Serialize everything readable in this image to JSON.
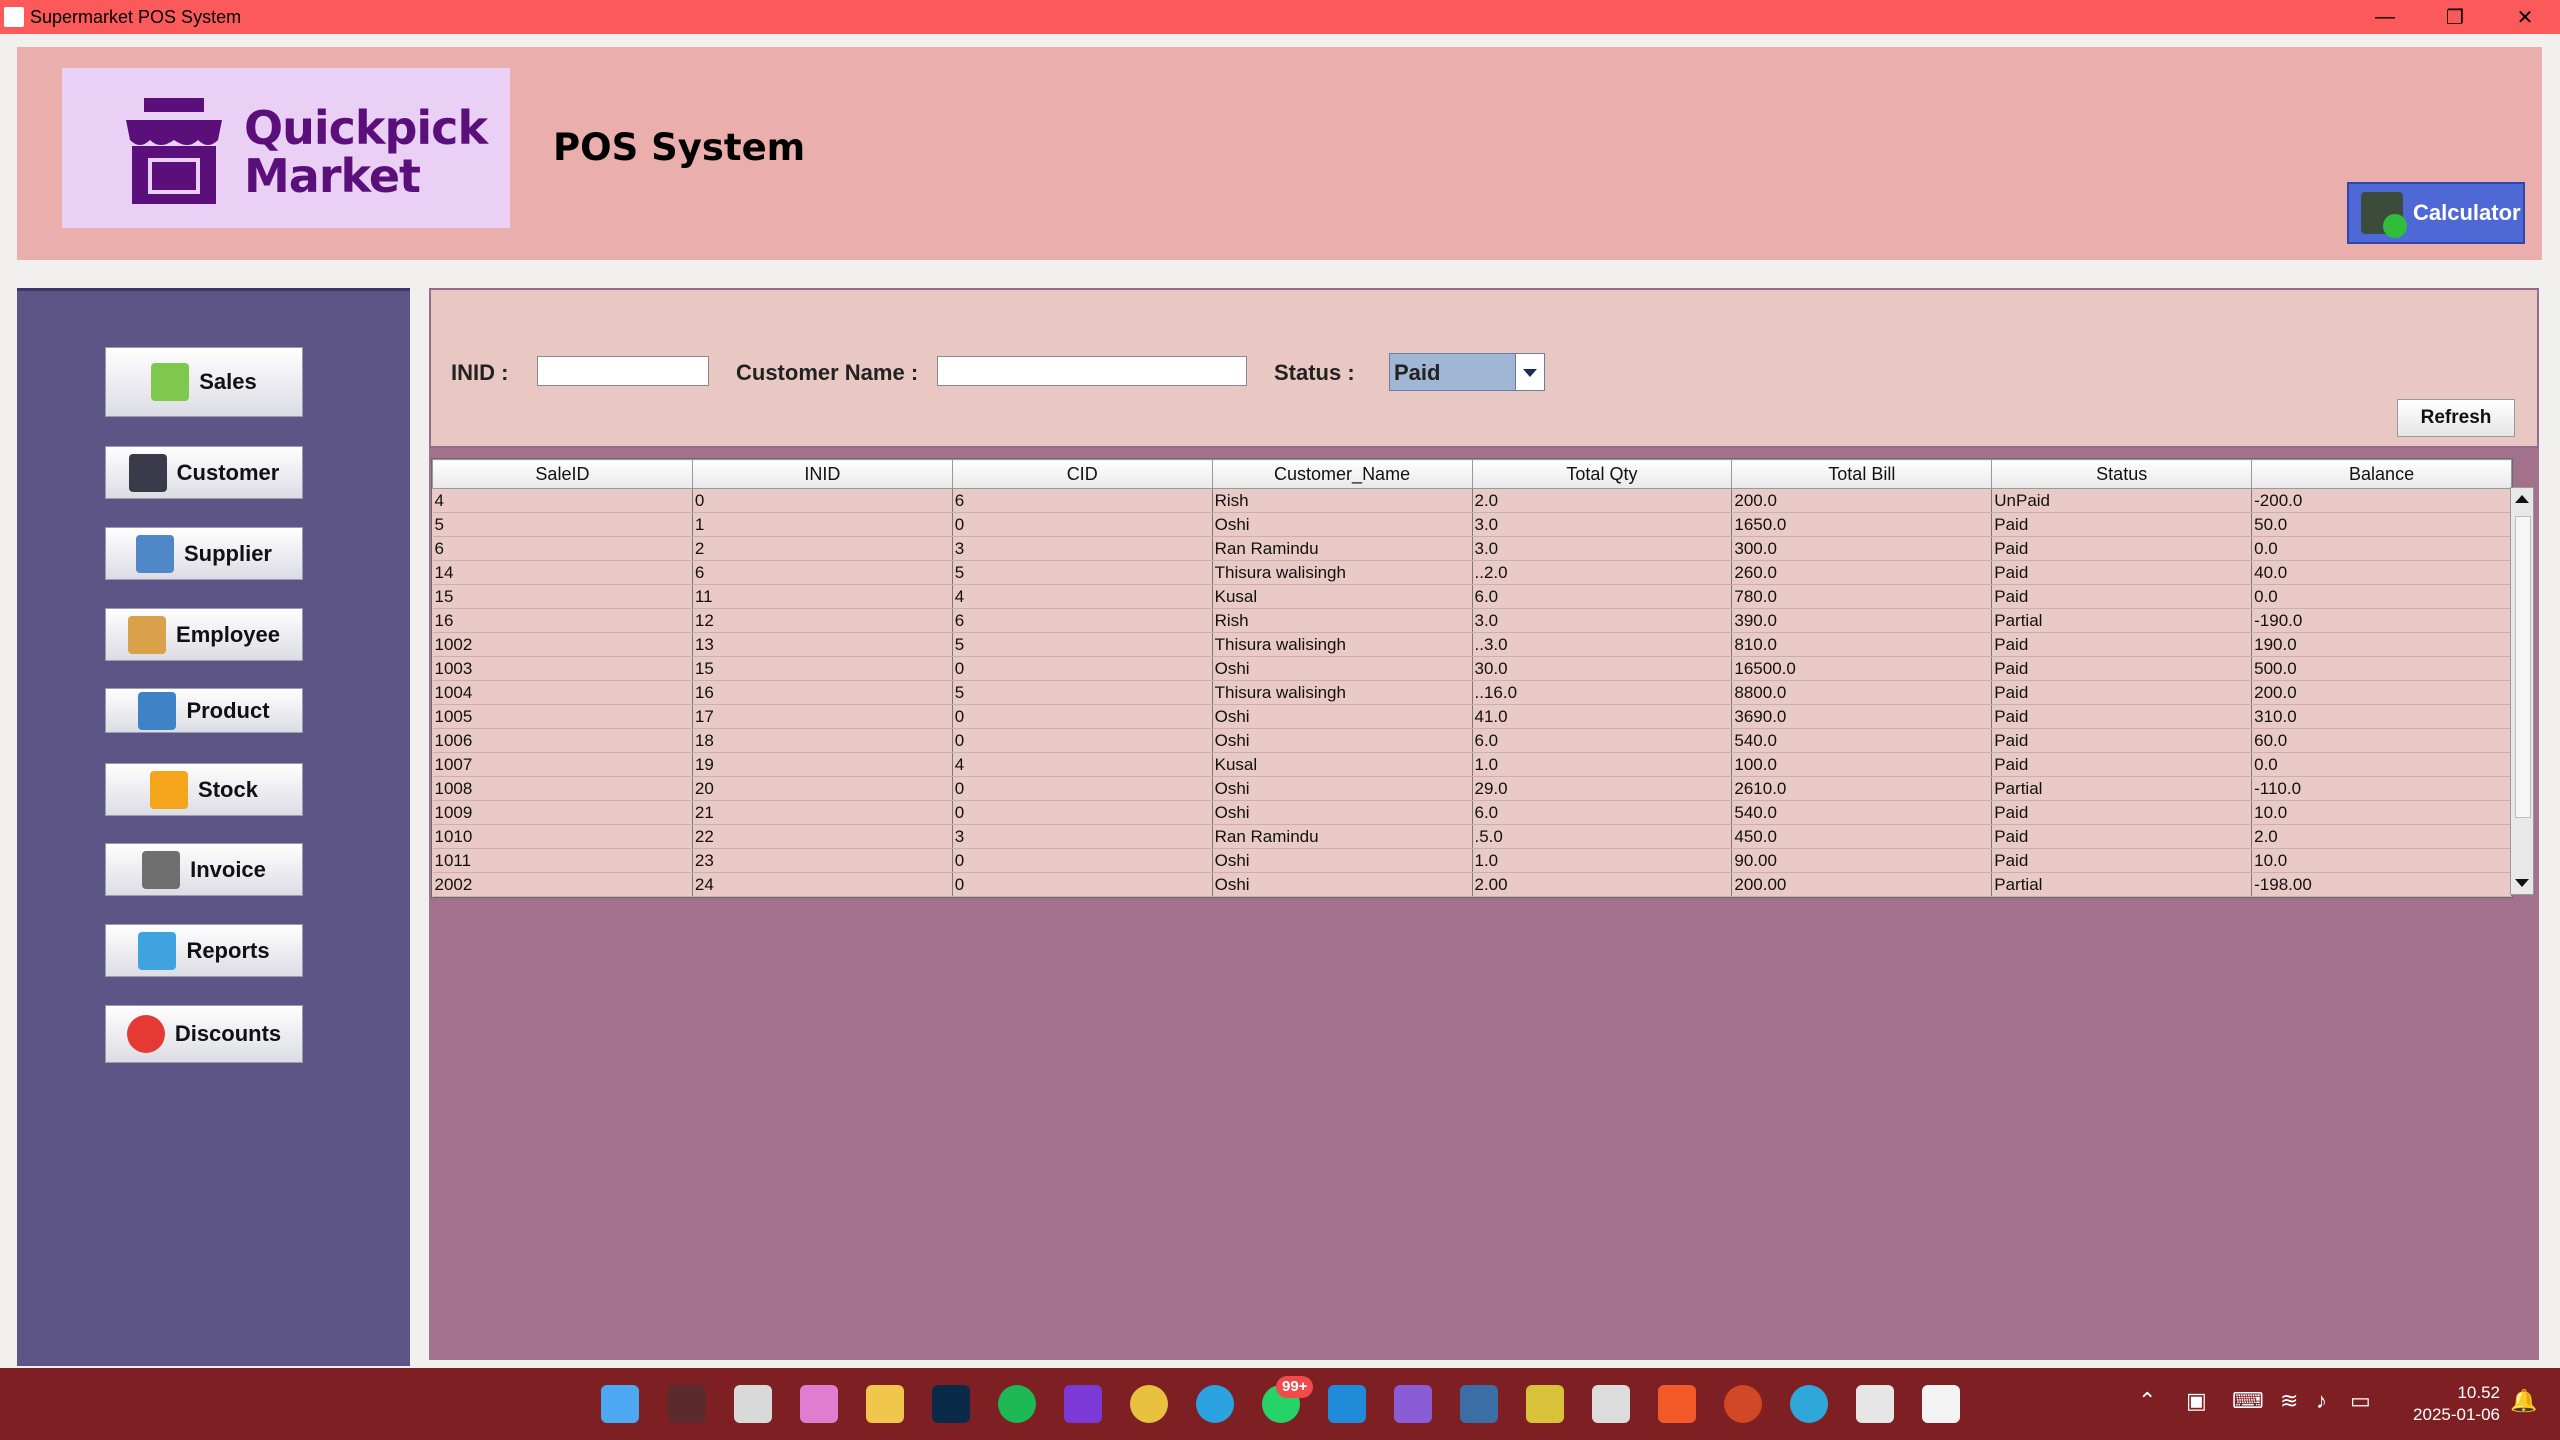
{
  "window": {
    "title": "Supermarket POS System",
    "minimize": "—",
    "maximize": "❐",
    "close": "✕"
  },
  "header": {
    "logo_line1": "Quickpick",
    "logo_line2": "Market",
    "page_title": "POS System",
    "calculator_label": "Calculator"
  },
  "sidebar": {
    "items": [
      {
        "label": "Sales",
        "icon": "sales-chart-icon"
      },
      {
        "label": "Customer",
        "icon": "customer-icon"
      },
      {
        "label": "Supplier",
        "icon": "supplier-icon"
      },
      {
        "label": "Employee",
        "icon": "employee-icon"
      },
      {
        "label": "Product",
        "icon": "product-icon"
      },
      {
        "label": "Stock",
        "icon": "stock-box-icon"
      },
      {
        "label": "Invoice",
        "icon": "invoice-icon"
      },
      {
        "label": "Reports",
        "icon": "reports-icon"
      },
      {
        "label": "Discounts",
        "icon": "discount-percent-icon"
      }
    ]
  },
  "filters": {
    "inid_label": "INID :",
    "inid_value": "",
    "customer_label": "Customer Name :",
    "customer_value": "",
    "status_label": "Status :",
    "status_value": "Paid",
    "refresh_label": "Refresh"
  },
  "table": {
    "columns": [
      "SaleID",
      "INID",
      "CID",
      "Customer_Name",
      "Total Qty",
      "Total Bill",
      "Status",
      "Balance"
    ],
    "rows": [
      [
        "4",
        "0",
        "6",
        "Rish",
        "2.0",
        "200.0",
        "UnPaid",
        "-200.0"
      ],
      [
        "5",
        "1",
        "0",
        "Oshi",
        "3.0",
        "1650.0",
        "Paid",
        "50.0"
      ],
      [
        "6",
        "2",
        "3",
        "Ran Ramindu",
        "3.0",
        "300.0",
        "Paid",
        "0.0"
      ],
      [
        "14",
        "6",
        "5",
        "Thisura walisingh",
        "..2.0",
        "260.0",
        "Paid",
        "40.0"
      ],
      [
        "15",
        "11",
        "4",
        "Kusal",
        "6.0",
        "780.0",
        "Paid",
        "0.0"
      ],
      [
        "16",
        "12",
        "6",
        "Rish",
        "3.0",
        "390.0",
        "Partial",
        "-190.0"
      ],
      [
        "1002",
        "13",
        "5",
        "Thisura walisingh",
        "..3.0",
        "810.0",
        "Paid",
        "190.0"
      ],
      [
        "1003",
        "15",
        "0",
        "Oshi",
        "30.0",
        "16500.0",
        "Paid",
        "500.0"
      ],
      [
        "1004",
        "16",
        "5",
        "Thisura walisingh",
        "..16.0",
        "8800.0",
        "Paid",
        "200.0"
      ],
      [
        "1005",
        "17",
        "0",
        "Oshi",
        "41.0",
        "3690.0",
        "Paid",
        "310.0"
      ],
      [
        "1006",
        "18",
        "0",
        "Oshi",
        "6.0",
        "540.0",
        "Paid",
        "60.0"
      ],
      [
        "1007",
        "19",
        "4",
        "Kusal",
        "1.0",
        "100.0",
        "Paid",
        "0.0"
      ],
      [
        "1008",
        "20",
        "0",
        "Oshi",
        "29.0",
        "2610.0",
        "Partial",
        "-110.0"
      ],
      [
        "1009",
        "21",
        "0",
        "Oshi",
        "6.0",
        "540.0",
        "Paid",
        "10.0"
      ],
      [
        "1010",
        "22",
        "3",
        "Ran Ramindu",
        ".5.0",
        "450.0",
        "Paid",
        "2.0"
      ],
      [
        "1011",
        "23",
        "0",
        "Oshi",
        "1.0",
        "90.00",
        "Paid",
        "10.0"
      ],
      [
        "2002",
        "24",
        "0",
        "Oshi",
        "2.00",
        "200.00",
        "Partial",
        "-198.00"
      ]
    ]
  },
  "taskbar": {
    "notification_badge": "99+",
    "clock_time": "10.52",
    "clock_date": "2025-01-06",
    "icons": [
      "windows-start-icon",
      "search-icon",
      "task-view-icon",
      "copilot-icon",
      "file-explorer-icon",
      "photoshop-icon",
      "spotify-icon",
      "visual-studio-purple-icon",
      "chrome-icon",
      "telegram-icon",
      "whatsapp-icon",
      "vscode-icon",
      "visual-studio-icon",
      "netbeans-icon",
      "app-icon",
      "blender-icon",
      "brave-icon",
      "powerpoint-icon",
      "edge-icon",
      "app-icon-2",
      "java-icon"
    ]
  },
  "colors": {
    "title_bar": "#fc5a5a",
    "header_bg": "#eaafad",
    "sidebar_bg": "#5c5585",
    "filter_bg": "#e9c8c4",
    "content_bg": "#a2728c",
    "table_bg": "#eacac6",
    "calculator_bg": "#4e69d6",
    "taskbar_bg": "#7e1f23"
  }
}
